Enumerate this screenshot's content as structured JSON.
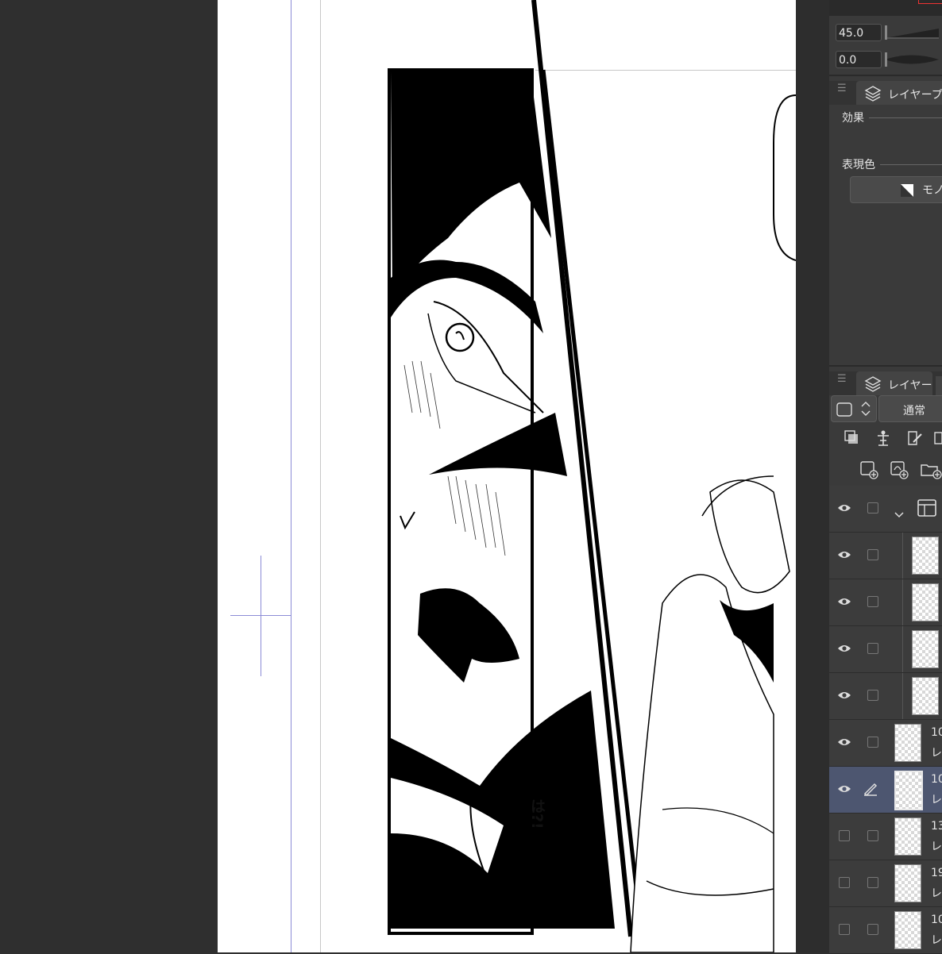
{
  "canvas": {
    "sfx_text": "は?!"
  },
  "tool_property": {
    "field1_value": "45.0",
    "field2_value": "0.0"
  },
  "layer_property_panel": {
    "title": "レイヤープ",
    "effect_label": "効果",
    "expression_color_label": "表現色",
    "mono_button_label": "モノ"
  },
  "layer_panel": {
    "title": "レイヤー",
    "blend_mode": "通常",
    "rows": [
      {
        "visible": true,
        "name_line1": "",
        "name_line2": ""
      },
      {
        "visible": true,
        "name_line1": "",
        "name_line2": ""
      },
      {
        "visible": true,
        "name_line1": "",
        "name_line2": ""
      },
      {
        "visible": true,
        "name_line1": "",
        "name_line2": ""
      },
      {
        "visible": true,
        "name_line1": "",
        "name_line2": ""
      },
      {
        "visible": true,
        "name_line1": "10",
        "name_line2": "レ"
      },
      {
        "visible": true,
        "name_line1": "10",
        "name_line2": "レ",
        "selected": true
      },
      {
        "visible": false,
        "name_line1": "13",
        "name_line2": "レ"
      },
      {
        "visible": false,
        "name_line1": "19",
        "name_line2": "レ"
      },
      {
        "visible": false,
        "name_line1": "10",
        "name_line2": "レ"
      }
    ]
  },
  "colors": {
    "workspace_bg": "#2f2f2f",
    "panel_bg": "#3a3a3a",
    "selected_row": "#4d5670",
    "guide_line": "#8c8cd6"
  }
}
